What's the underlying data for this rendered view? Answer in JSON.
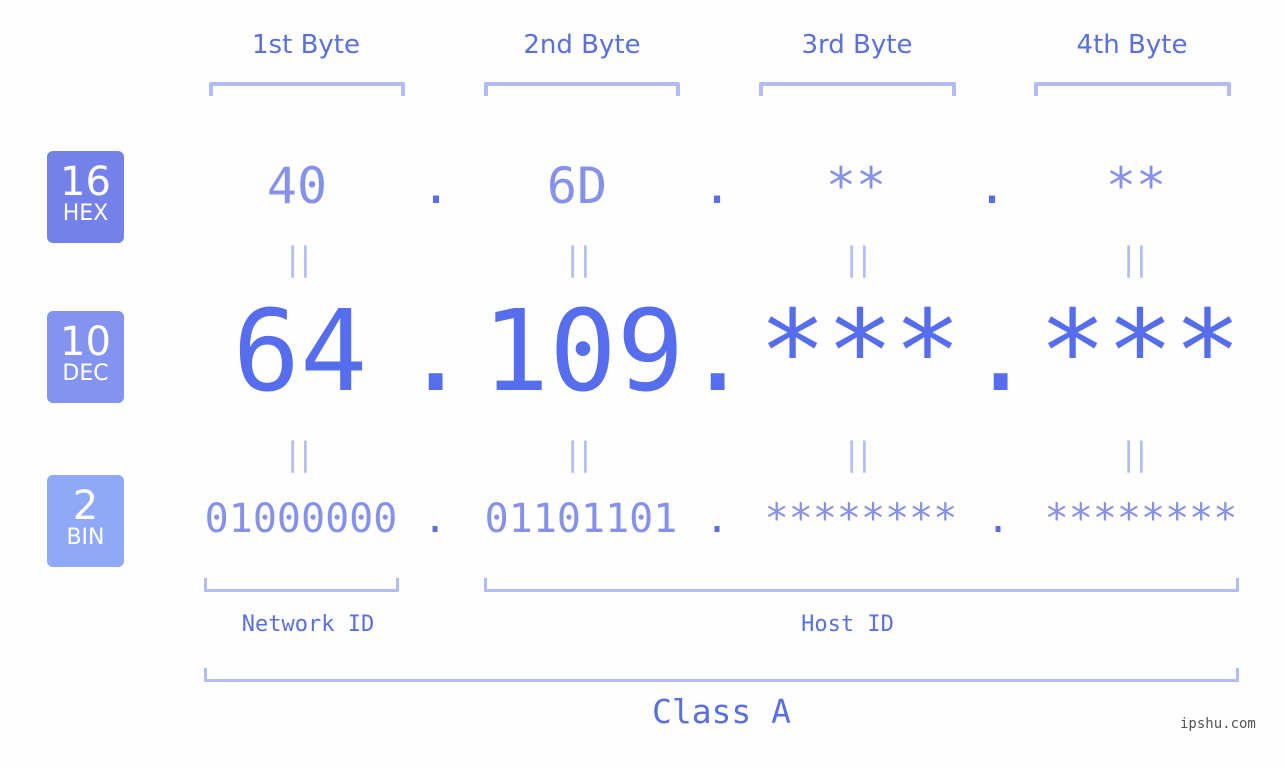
{
  "ip_address": {
    "display": "64.109.***.***",
    "class": "Class A"
  },
  "byte_headers": [
    "1st Byte",
    "2nd Byte",
    "3rd Byte",
    "4th Byte"
  ],
  "bases": [
    {
      "number": "16",
      "label": "HEX",
      "color": "#7481ea"
    },
    {
      "number": "10",
      "label": "DEC",
      "color": "#8493f0"
    },
    {
      "number": "2",
      "label": "BIN",
      "color": "#8fa8f8"
    }
  ],
  "hex": {
    "bytes": [
      "40",
      "6D",
      "**",
      "**"
    ],
    "separator": "."
  },
  "dec": {
    "bytes": [
      "64",
      "109",
      "***",
      "***"
    ],
    "separator": "."
  },
  "bin": {
    "bytes": [
      "01000000",
      "01101101",
      "********",
      "********"
    ],
    "separator": "."
  },
  "equals_symbol": "||",
  "network_id_label": "Network ID",
  "host_id_label": "Host ID",
  "class_label": "Class A",
  "watermark": "ipshu.com",
  "colors": {
    "primary": "#566ded",
    "secondary_text": "#8591ea",
    "bracket": "#b3bcf6",
    "background": "#fdfefd"
  }
}
